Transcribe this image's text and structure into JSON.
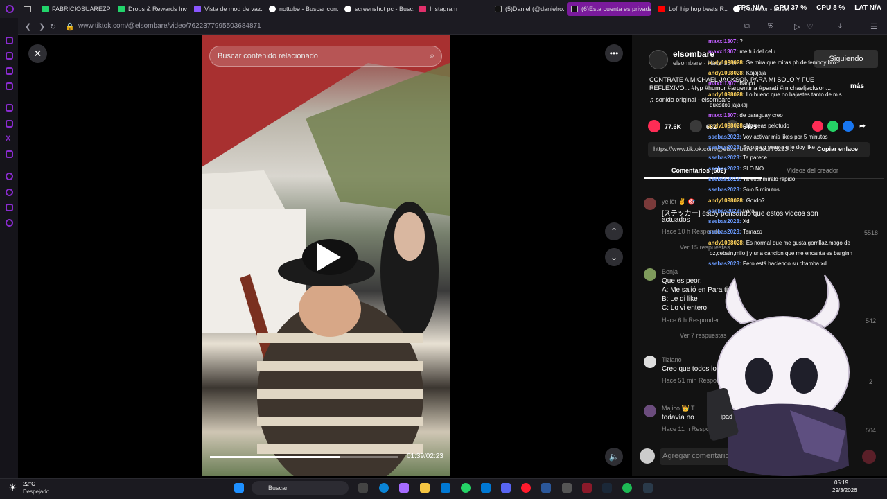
{
  "tabs": [
    {
      "label": "FABRICIOSUAREZPD...",
      "color": "#22d46b"
    },
    {
      "label": "Drops & Rewards Inv...",
      "color": "#22d46b"
    },
    {
      "label": "Vista de mod de vaz...",
      "color": "#8a56ff"
    },
    {
      "label": "nottube - Buscar con...",
      "color": "#ffffff"
    },
    {
      "label": "screenshot pc - Busc...",
      "color": "#ffffff"
    },
    {
      "label": "Instagram",
      "color": "#e1306c"
    },
    {
      "label": "(5)Daniel (@danielro...",
      "color": "#ffffff"
    },
    {
      "label": "(6)Esta cuenta es privada",
      "color": "#ffffff"
    },
    {
      "label": "Lofi hip hop beats R...",
      "color": "#ff0000"
    },
    {
      "label": "traductor - Buscar c...",
      "color": "#ffffff"
    }
  ],
  "perf": {
    "fps": "FPS N/A",
    "gpu": "GPU 37 %",
    "cpu": "CPU 8 %",
    "lat": "LAT N/A"
  },
  "browser": {
    "url": "www.tiktok.com/@elsombare/video/7622377995503684871"
  },
  "video": {
    "search_placeholder": "Buscar contenido relacionado",
    "time": "01:39/02:23",
    "progress": 0.69
  },
  "post": {
    "username": "elsombare",
    "subline": "elsombare · Hace 15 h",
    "follow": "Siguiendo",
    "caption": "CONTRATE A MICHAEL JACKSON PARA MI SOLO Y FUE REFLEXIVO... #fyp #humor #argentina #parati #michaeljackson...",
    "more": "más",
    "sound": "♫  sonido original - elsombare",
    "likes": "77.6K",
    "comments": "682",
    "saves": "6475",
    "link": "https://www.tiktok.com/@elsombare/video/76223...",
    "copy": "Copiar enlace",
    "tab_comments": "Comentarios (682)",
    "tab_creator": "Videos del creador",
    "add_comment": "Agregar comentario..."
  },
  "comments": [
    {
      "user": "yeliöt ✌ 🎯",
      "text1": "[ステッカー] estoy pensando que estos videos son",
      "text2": "actuados",
      "meta": "Hace 10 h    Responder",
      "likes": "5518",
      "replies": "Ver 15 respuestas",
      "color": "#7a3a3a"
    },
    {
      "user": "Benja",
      "text1": "Que es peor:",
      "text2": "A: Me salió en Para ti",
      "text3": "B: Le di like",
      "text4": "C: Lo vi entero",
      "meta": "Hace 6 h    Responder",
      "likes": "542",
      "replies": "Ver 7 respuestas",
      "color": "#7f9b5c"
    },
    {
      "user": "Tiziano",
      "text1": "Creo que todos los p",
      "meta": "Hace 51 min    Responder",
      "likes": "2",
      "color": "#dddddd"
    },
    {
      "user": "Majico 👑 T",
      "text1": "todavía no",
      "meta": "Hace 11 h    Responder",
      "likes": "504",
      "color": "#6b4c7d"
    }
  ],
  "chat": [
    {
      "n": "maxxl1307:",
      "m": "?",
      "c": "n"
    },
    {
      "n": "maxxl1307:",
      "m": "me fui del celu",
      "c": "n"
    },
    {
      "n": "andy1098028:",
      "m": "Se mira que miras ph de femboy bro",
      "c": "n2"
    },
    {
      "n": "andy1098028:",
      "m": "Kajajaja",
      "c": "n2"
    },
    {
      "n": "maxxl1307:",
      "m": "banco",
      "c": "n"
    },
    {
      "n": "andy1098028:",
      "m": "Lo bueno que no bajastes tanto de mis",
      "c": "n2"
    },
    {
      "n": "",
      "m": "quesitos jajakaj",
      "c": "n2"
    },
    {
      "n": "maxxl1307:",
      "m": "de paraguay creo",
      "c": "n"
    },
    {
      "n": "andy1098028:",
      "m": "No seas pelotudo",
      "c": "n2"
    },
    {
      "n": "ssebas2023:",
      "m": "Voy activar mis likes por 5 minutos",
      "c": "n3"
    },
    {
      "n": "ssebas2023:",
      "m": "Solo pa q veas a q le doy like",
      "c": "n3"
    },
    {
      "n": "ssebas2023:",
      "m": "Te parece",
      "c": "n3"
    },
    {
      "n": "ssebas2023:",
      "m": "SI O NO",
      "c": "n3"
    },
    {
      "n": "ssebas2023:",
      "m": "Ya está míralo rápido",
      "c": "n3"
    },
    {
      "n": "ssebas2023:",
      "m": "Solo 5 minutos",
      "c": "n3"
    },
    {
      "n": "andy1098028:",
      "m": "Gordo?",
      "c": "n2"
    },
    {
      "n": "ssebas2023:",
      "m": "Para",
      "c": "n3"
    },
    {
      "n": "ssebas2023:",
      "m": "Xd",
      "c": "n3"
    },
    {
      "n": "ssebas2023:",
      "m": "Temazo",
      "c": "n3"
    },
    {
      "n": "andy1098028:",
      "m": "Es normal que me gusta gorrillaz,mago de",
      "c": "n2"
    },
    {
      "n": "",
      "m": "oz,cebain,milo j y una cancion que me encanta es barginn",
      "c": "n2"
    },
    {
      "n": "ssebas2023:",
      "m": "Pero está haciendo su chamba xd",
      "c": "n3"
    }
  ],
  "weather": {
    "temp": "22°C",
    "cond": "Despejado"
  },
  "taskbar": {
    "search": "Buscar",
    "time": "05:19",
    "date": "29/3/2026"
  },
  "colors": {
    "accent": "#7a1a9c",
    "heart": "#fe2c55",
    "chat_user": "#c15fff"
  }
}
